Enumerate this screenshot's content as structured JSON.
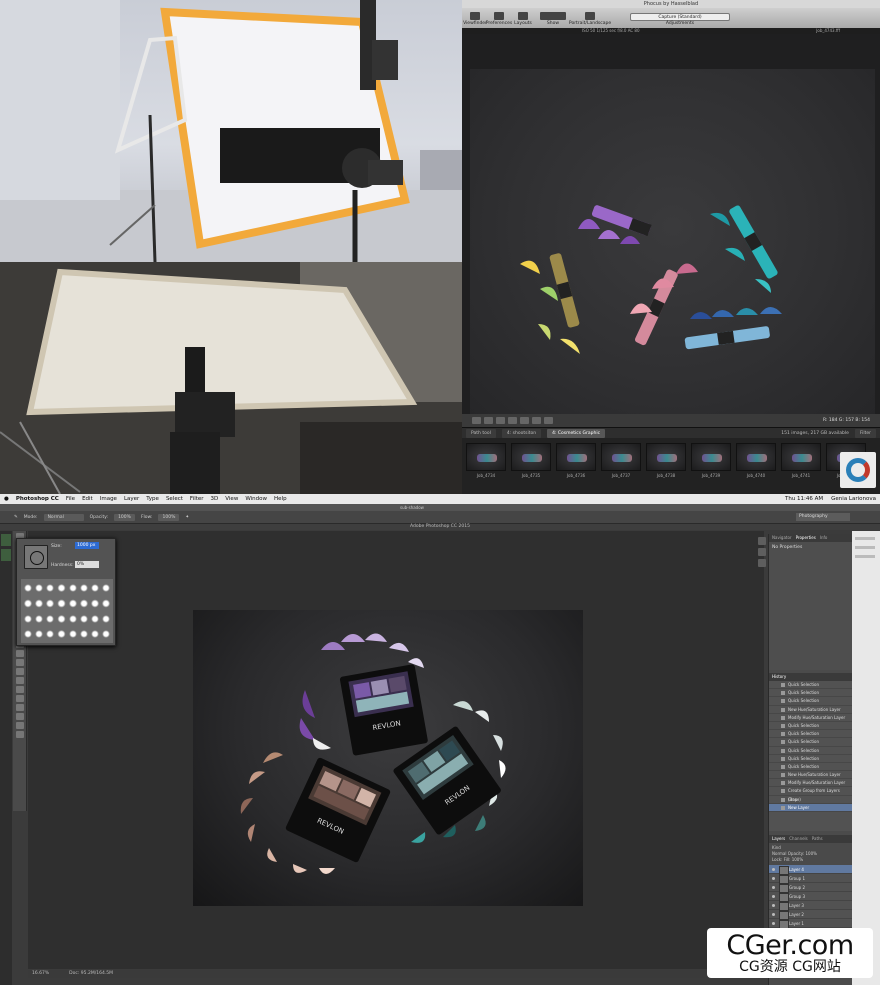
{
  "phocus": {
    "window_title": "Phocus by Hasselblad",
    "toolbar": [
      {
        "label": "Viewfinder",
        "icon": "viewfinder-icon"
      },
      {
        "label": "Preferences",
        "icon": "preferences-icon"
      },
      {
        "label": "Layouts",
        "icon": "layouts-icon"
      },
      {
        "label": "Show",
        "icon": "show-icon"
      },
      {
        "label": "Portrait/Landscape",
        "icon": "portrait-landscape-icon"
      }
    ],
    "capture_select": "Capture (Standard)",
    "adjustments_label": "Adjustments",
    "info_left": "ISO 50  1/125 sec  f/8.0  AC 80",
    "info_right": "Job_4743.fff",
    "readout": "R: 184  G: 157  B: 154",
    "tabs": [
      "Path tool",
      "4: shootsiton",
      "4: Cosmetics Graphic"
    ],
    "active_tab": "4: Cosmetics Graphic",
    "status": "151 images, 217 GB available",
    "filter_label": "Filter",
    "thumbnails": [
      "Job_4734",
      "Job_4735",
      "Job_4736",
      "Job_4737",
      "Job_4738",
      "Job_4739",
      "Job_4740",
      "Job_4741",
      "Job_4742"
    ],
    "brand": "REVLON"
  },
  "menubar": {
    "app": "Photoshop CC",
    "items": [
      "File",
      "Edit",
      "Image",
      "Layer",
      "Type",
      "Select",
      "Filter",
      "3D",
      "View",
      "Window",
      "Help"
    ],
    "clock": "Thu 11:46 AM",
    "user": "Genia Larionova"
  },
  "photoshop": {
    "doc_tab": "sub-shadow",
    "title": "Adobe Photoshop CC 2015",
    "options": {
      "mode_label": "Mode:",
      "mode_value": "Normal",
      "opacity_label": "Opacity:",
      "opacity_value": "100%",
      "flow_label": "Flow:",
      "flow_value": "100%"
    },
    "workspace": "Photography",
    "brush_popup": {
      "size_label": "Size:",
      "size_value": "1000 px",
      "hardness_label": "Hardness:",
      "hardness_value": "0%"
    },
    "properties_tabs": [
      "Navigator",
      "Properties",
      "Info"
    ],
    "properties_active": "Properties",
    "properties_body": "No Properties",
    "history_title": "History",
    "history_items": [
      "Quick Selection",
      "Quick Selection",
      "Quick Selection",
      "New Hue/Saturation Layer",
      "Modify Hue/Saturation Layer",
      "Quick Selection",
      "Quick Selection",
      "Quick Selection",
      "Quick Selection",
      "Quick Selection",
      "Quick Selection",
      "New Hue/Saturation Layer",
      "Modify Hue/Saturation Layer",
      "Create Group from Layers (Base)",
      "Crop",
      "New Layer"
    ],
    "history_active_index": 15,
    "layers_tabs": [
      "Layers",
      "Channels",
      "Paths"
    ],
    "layers_kind": "Kind",
    "layers_blend": "Normal",
    "layers_opacity": "Opacity: 100%",
    "layers_lock": "Lock:",
    "layers_fill": "Fill: 100%",
    "layers": [
      "Layer 4",
      "Group 1",
      "Group 2",
      "Group 3",
      "Layer 3",
      "Layer 2",
      "Layer 1",
      "Background copy"
    ],
    "layers_active_index": 0,
    "status_zoom": "16.67%",
    "status_doc": "Doc: 95.2M/164.5M",
    "brand": "REVLON",
    "product_line": "PHOTOREADY"
  },
  "watermark": {
    "logo": "CGer.com",
    "subtitle": "CG资源  CG网站"
  }
}
